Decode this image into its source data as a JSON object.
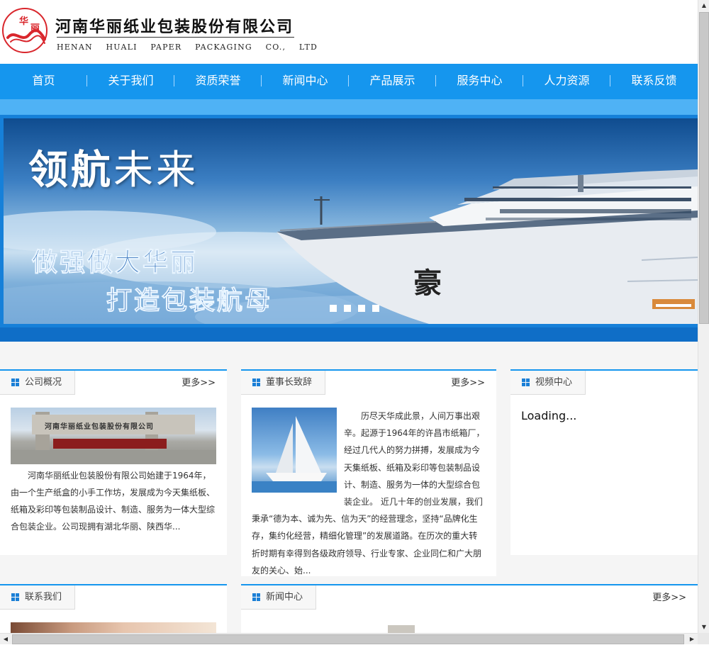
{
  "header": {
    "logo_chars": [
      "华",
      "丽"
    ],
    "company_cn": "河南华丽纸业包装股份有限公司",
    "company_en": "HENAN HUALI PAPER PACKAGING CO., LTD"
  },
  "nav": {
    "items": [
      {
        "label": "首页"
      },
      {
        "label": "关于我们"
      },
      {
        "label": "资质荣誉"
      },
      {
        "label": "新闻中心"
      },
      {
        "label": "产品展示"
      },
      {
        "label": "服务中心"
      },
      {
        "label": "人力资源"
      },
      {
        "label": "联系反馈"
      }
    ]
  },
  "banner": {
    "title_bold": "领航",
    "title_light": "未来",
    "slogan1": "做强做大华丽",
    "slogan2": "打造包装航母",
    "ship_mark": "豪",
    "slide_count": 4
  },
  "panels": {
    "overview": {
      "title": "公司概况",
      "more": "更多>>",
      "photo_sign": "河南华丽纸业包装股份有限公司",
      "text": "河南华丽纸业包装股份有限公司始建于1964年，由一个生产纸盒的小手工作坊，发展成为今天集纸板、纸箱及彩印等包装制品设计、制造、服务为一体大型综合包装企业。公司现拥有湖北华丽、陕西华..."
    },
    "chairman": {
      "title": "董事长致辞",
      "more": "更多>>",
      "text": "历尽天华成此景，人间万事出艰辛。起源于1964年的许昌市纸箱厂，经过几代人的努力拼搏，发展成为今天集纸板、纸箱及彩印等包装制品设计、制造、服务为一体的大型综合包装企业。 近几十年的创业发展，我们秉承“德为本、诚为先、信为天”的经营理念，坚持“品牌化生存，集约化经营，精细化管理”的发展道路。在历次的重大转折时期有幸得到各级政府领导、行业专家、企业同仁和广大朋友的关心、始..."
    },
    "video": {
      "title": "视频中心",
      "loading": "Loading..."
    },
    "contact": {
      "title": "联系我们"
    },
    "news": {
      "title": "新闻中心",
      "more": "更多>>"
    }
  },
  "colors": {
    "nav_blue": "#1596ee",
    "banner_blue": "#1680d9",
    "logo_red": "#d9262c"
  }
}
